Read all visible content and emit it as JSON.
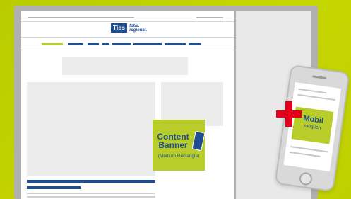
{
  "logo": {
    "brand": "Tips",
    "claim_line1": "total.",
    "claim_line2": "regional."
  },
  "content_banner": {
    "title_line1": "Content",
    "title_line2": "Banner",
    "subtitle": "(Medium Rectangle)"
  },
  "mobile_teaser": {
    "title": "Mobil",
    "subtitle": "möglich"
  },
  "colors": {
    "background": "#c2d400",
    "brand_blue": "#1f4e91",
    "accent_green": "#b8cd2a",
    "plus_red": "#e3001b"
  }
}
